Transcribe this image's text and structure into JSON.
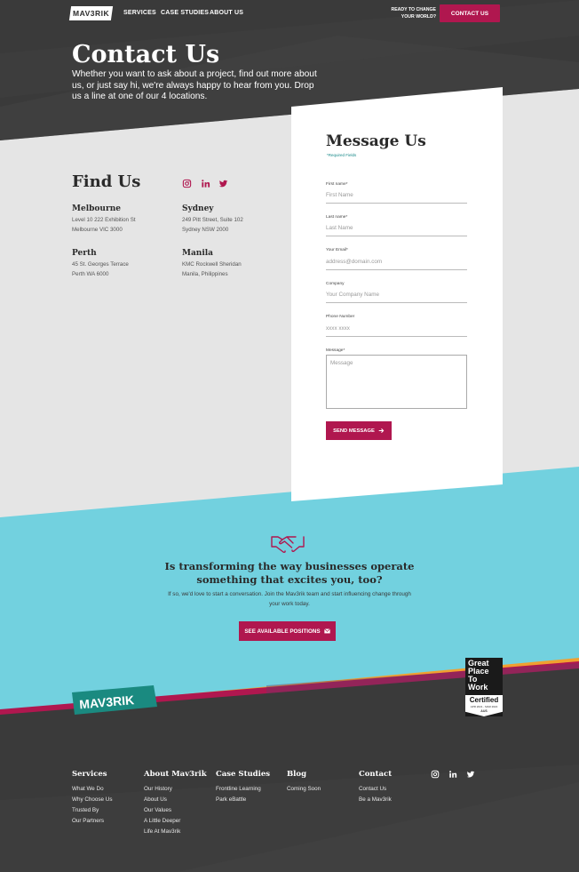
{
  "nav": {
    "logo": "MAV3RIK",
    "items": [
      "SERVICES",
      "CASE STUDIES",
      "ABOUT US"
    ],
    "ready_line1": "READY TO CHANGE",
    "ready_line2": "YOUR WORLD?",
    "contact_button": "CONTACT US"
  },
  "hero": {
    "title": "Contact Us",
    "description": "Whether you want to ask about a project, find out more about us, or just say hi, we're always happy to hear from you. Drop us a line at one of our 4 locations."
  },
  "find_us": {
    "title": "Find Us",
    "social_icons": [
      "instagram-icon",
      "linkedin-icon",
      "twitter-icon"
    ],
    "locations": [
      {
        "city": "Melbourne",
        "line1": "Level 10 222 Exhibition St",
        "line2": "Melbourne VIC 3000"
      },
      {
        "city": "Sydney",
        "line1": "249 Pitt Street, Suite 102",
        "line2": "Sydney NSW 2000"
      },
      {
        "city": "Perth",
        "line1": "45 St. Georges Terrace",
        "line2": "Perth WA 6000"
      },
      {
        "city": "Manila",
        "line1": "KMC Rockwell Sheridan",
        "line2": "Manila, Philippines"
      }
    ]
  },
  "form": {
    "title": "Message Us",
    "required_note": "*Required Fields",
    "fields": [
      {
        "label": "First name*",
        "placeholder": "First Name"
      },
      {
        "label": "Last name*",
        "placeholder": "Last Name"
      },
      {
        "label": "Your Email*",
        "placeholder": "address@domain.com"
      },
      {
        "label": "Company",
        "placeholder": "Your Company Name"
      },
      {
        "label": "Phone Number",
        "placeholder": "xxxx xxxx"
      }
    ],
    "message_label": "Message*",
    "message_placeholder": "Message",
    "send_button": "SEND MESSAGE"
  },
  "cta": {
    "title": "Is transforming the way businesses operate something that excites you, too?",
    "description": "If so, we'd love to start a conversation. Join the Mav3rik team and start influencing change through your work today.",
    "button": "SEE AVAILABLE POSITIONS"
  },
  "footer": {
    "logo": "MAV3RIK",
    "badge": {
      "line1": "Great",
      "line2": "Place",
      "line3": "To",
      "line4": "Work",
      "certified": "Certified",
      "dates": "APR 2021 - MAR 2022",
      "country": "AUS"
    },
    "columns": [
      {
        "heading": "Services",
        "links": [
          "What We Do",
          "Why Choose Us",
          "Trusted By",
          "Our Partners"
        ]
      },
      {
        "heading": "About Mav3rik",
        "links": [
          "Our History",
          "About Us",
          "Our Values",
          "A Little Deeper",
          "Life At Mav3rik"
        ]
      },
      {
        "heading": "Case Studies",
        "links": [
          "Frontline Learning",
          "Park eBattle"
        ]
      },
      {
        "heading": "Blog",
        "links": [
          "Coming Soon"
        ]
      },
      {
        "heading": "Contact",
        "links": [
          "Contact Us",
          "Be a Mav3rik"
        ]
      }
    ]
  },
  "colors": {
    "dark": "#3a3a3a",
    "light_gray": "#e5e5e5",
    "teal": "#72d1df",
    "brand_pink": "#b0174f",
    "footer_logo_teal": "#1a8a80"
  }
}
